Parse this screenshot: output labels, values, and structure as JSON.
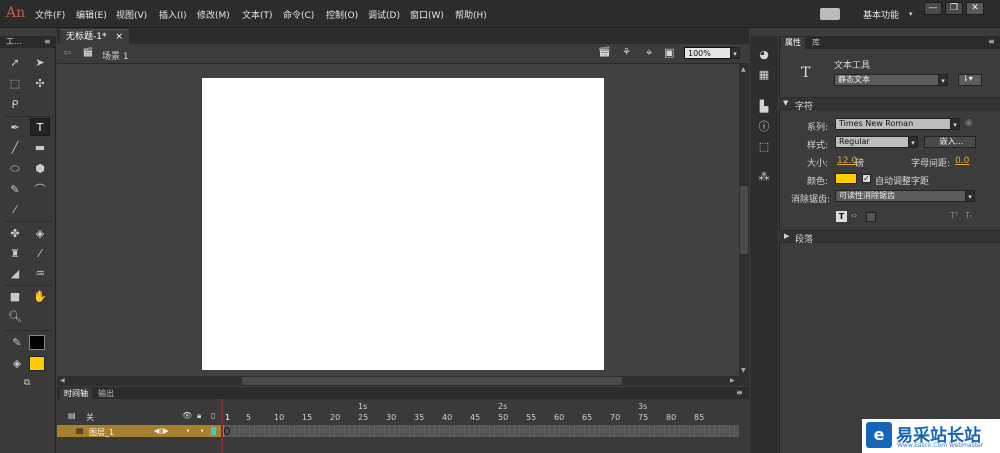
{
  "app": {
    "logo": "An",
    "menu": [
      "文件(F)",
      "编辑(E)",
      "视图(V)",
      "插入(I)",
      "修改(M)",
      "文本(T)",
      "命令(C)",
      "控制(O)",
      "调试(D)",
      "窗口(W)",
      "帮助(H)"
    ],
    "workspace": "基本功能",
    "window_buttons": [
      "—",
      "❐",
      "✕"
    ]
  },
  "tools_panel": {
    "title": "工..."
  },
  "document": {
    "tab": "无标题-1*",
    "tab_close": "×",
    "scene": "场景 1",
    "zoom": "100%"
  },
  "timeline": {
    "tabs": [
      "时间轴",
      "输出"
    ],
    "seconds": [
      "1s",
      "2s",
      "3s"
    ],
    "frame_numbers": [
      "1",
      "5",
      "10",
      "15",
      "20",
      "25",
      "30",
      "35",
      "40",
      "45",
      "50",
      "55",
      "60",
      "65",
      "70",
      "75",
      "80",
      "85"
    ],
    "header_label": "关",
    "layer_name": "图层_1"
  },
  "properties": {
    "tabs": [
      "属性",
      "库"
    ],
    "tool_name": "文本工具",
    "text_type": "静态文本",
    "char_section": "字符",
    "family_label": "系列:",
    "family_value": "Times New Roman",
    "style_label": "样式:",
    "style_value": "Regular",
    "embed_button": "嵌入...",
    "size_label": "大小:",
    "size_value": "12.0",
    "size_unit": "磅",
    "spacing_label": "字母间距:",
    "spacing_value": "0.0",
    "color_label": "颜色:",
    "color_value": "#ffcc00",
    "auto_kern_label": "自动调整字距",
    "antialias_label": "消除锯齿:",
    "antialias_value": "可读性消除锯齿",
    "paragraph_section": "段落"
  },
  "colors": {
    "stroke": "#000000",
    "fill": "#ffcc00",
    "layer_highlight": "#a77f2f"
  },
  "watermark": {
    "logo_char": "e",
    "text": "易采站长站",
    "url": "Www.Easck.Com Webmaster"
  }
}
